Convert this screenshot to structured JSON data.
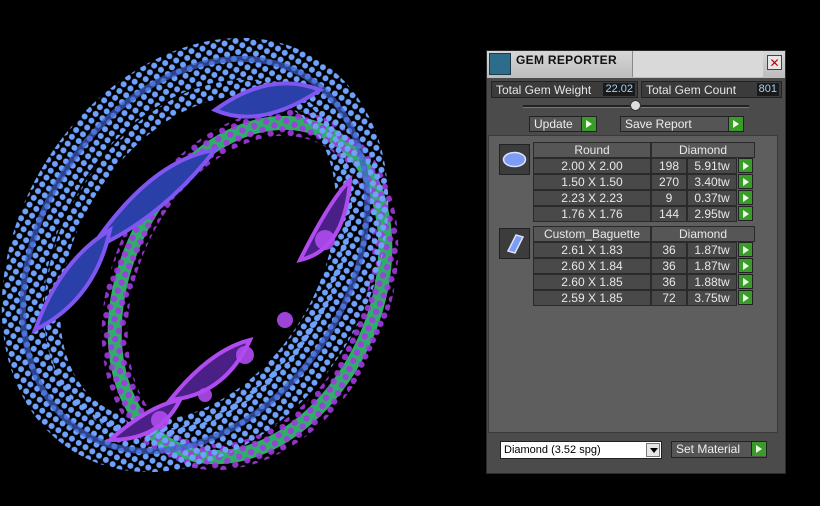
{
  "panel": {
    "title": "GEM REPORTER",
    "close_label": "✕",
    "total_gem_weight_label": "Total Gem Weight",
    "total_gem_weight_value": "22.02",
    "total_gem_count_label": "Total Gem Count",
    "total_gem_count_value": "801",
    "update_label": "Update",
    "save_report_label": "Save Report",
    "material_select_value": "Diamond    (3.52 spg)",
    "set_material_label": "Set Material"
  },
  "groups": [
    {
      "icon": "round-gem-icon",
      "shape": "Round",
      "material": "Diamond",
      "rows": [
        {
          "size": "2.00 X 2.00",
          "count": "198",
          "weight": "5.91tw"
        },
        {
          "size": "1.50 X 1.50",
          "count": "270",
          "weight": "3.40tw"
        },
        {
          "size": "2.23 X 2.23",
          "count": "9",
          "weight": "0.37tw"
        },
        {
          "size": "1.76 X 1.76",
          "count": "144",
          "weight": "2.95tw"
        }
      ]
    },
    {
      "icon": "baguette-gem-icon",
      "shape": "Custom_Baguette",
      "material": "Diamond",
      "rows": [
        {
          "size": "2.61 X 1.83",
          "count": "36",
          "weight": "1.87tw"
        },
        {
          "size": "2.60 X 1.84",
          "count": "36",
          "weight": "1.87tw"
        },
        {
          "size": "2.60 X 1.85",
          "count": "36",
          "weight": "1.88tw"
        },
        {
          "size": "2.59 X 1.85",
          "count": "72",
          "weight": "3.75tw"
        }
      ]
    }
  ],
  "colors": {
    "viewport_bg": "#000000",
    "panel_bg": "#4b4b4b",
    "go_button": "#3a9a2a",
    "value_text": "#9dd4ff",
    "gem_blue": "#5b8ff0",
    "gem_purple": "#9a32d8",
    "gem_green": "#2fae6a"
  }
}
